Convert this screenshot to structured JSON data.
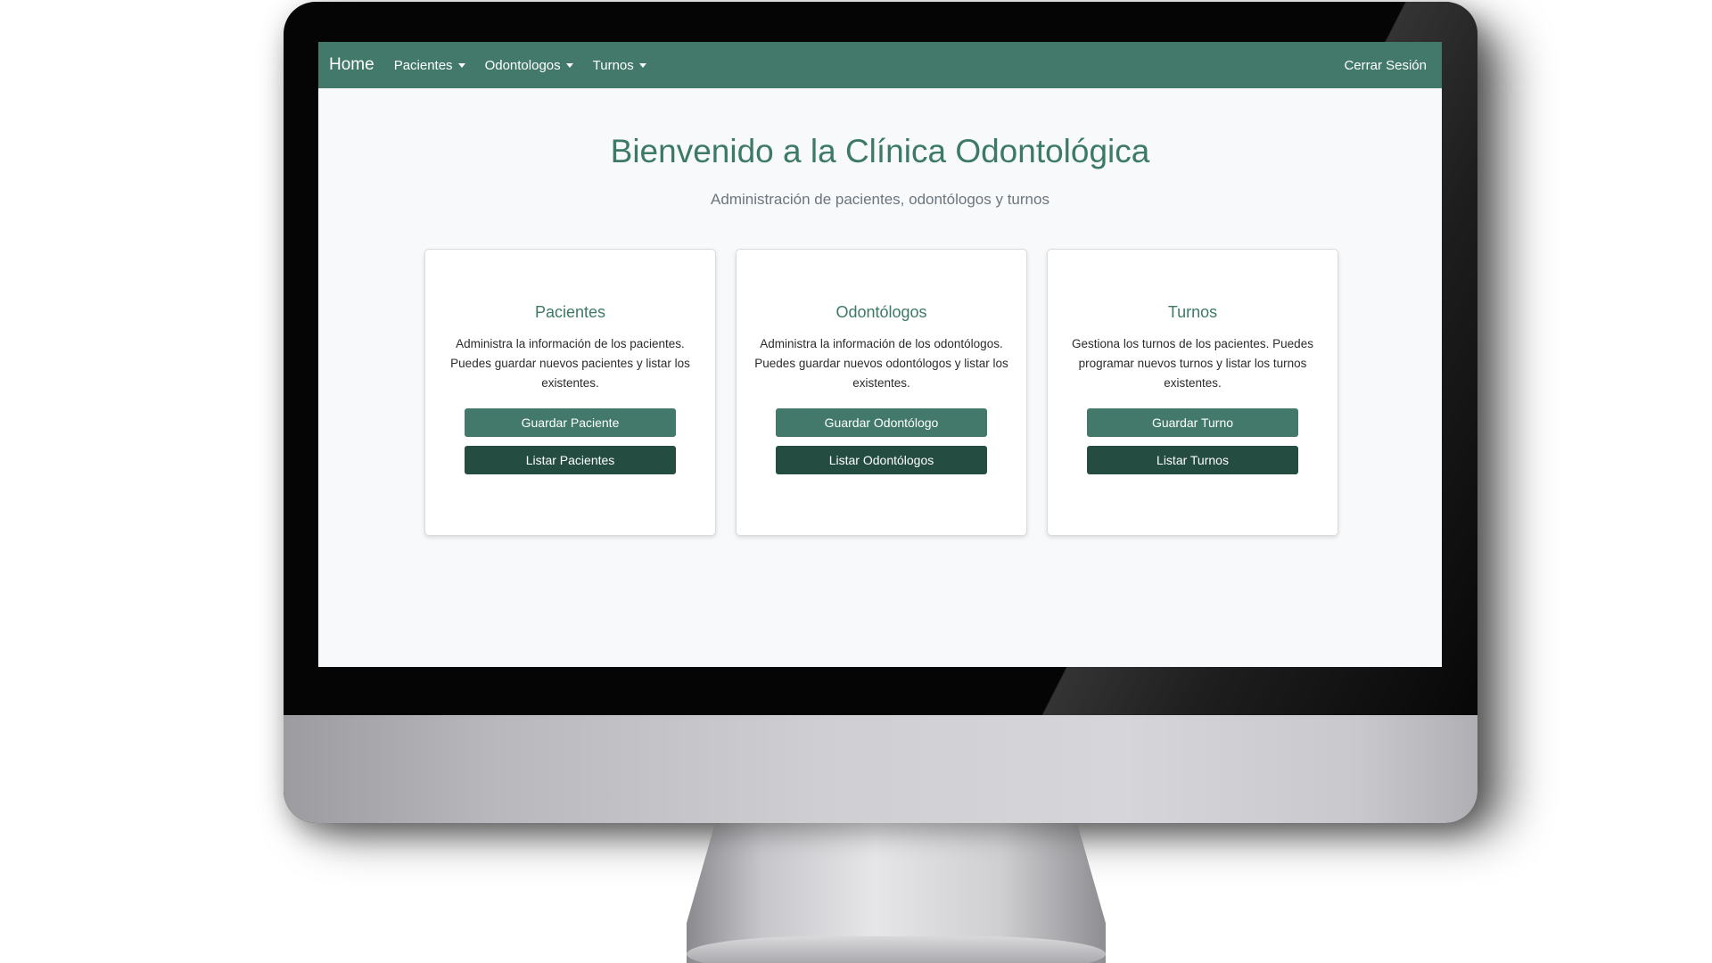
{
  "navbar": {
    "brand": "Home",
    "menus": [
      {
        "label": "Pacientes",
        "icon": "caret-down-icon"
      },
      {
        "label": "Odontologos",
        "icon": "caret-down-icon"
      },
      {
        "label": "Turnos",
        "icon": "caret-down-icon"
      }
    ],
    "logout": "Cerrar Sesión"
  },
  "hero": {
    "title": "Bienvenido a la Clínica Odontológica",
    "subtitle": "Administración de pacientes, odontólogos y turnos"
  },
  "cards": [
    {
      "title": "Pacientes",
      "text": "Administra la información de los pacientes. Puedes guardar nuevos pacientes y listar los existentes.",
      "primary_button": "Guardar Paciente",
      "secondary_button": "Listar Pacientes"
    },
    {
      "title": "Odontólogos",
      "text": "Administra la información de los odontólogos. Puedes guardar nuevos odontólogos y listar los existentes.",
      "primary_button": "Guardar Odontólogo",
      "secondary_button": "Listar Odontólogos"
    },
    {
      "title": "Turnos",
      "text": "Gestiona los turnos de los pacientes. Puedes programar nuevos turnos y listar los turnos existentes.",
      "primary_button": "Guardar Turno",
      "secondary_button": "Listar Turnos"
    }
  ],
  "colors": {
    "navbar": "#43796a",
    "accent_text": "#3d7a65",
    "primary_button": "#43796a",
    "secondary_button": "#244c40",
    "page_background": "#f8f9fa"
  }
}
